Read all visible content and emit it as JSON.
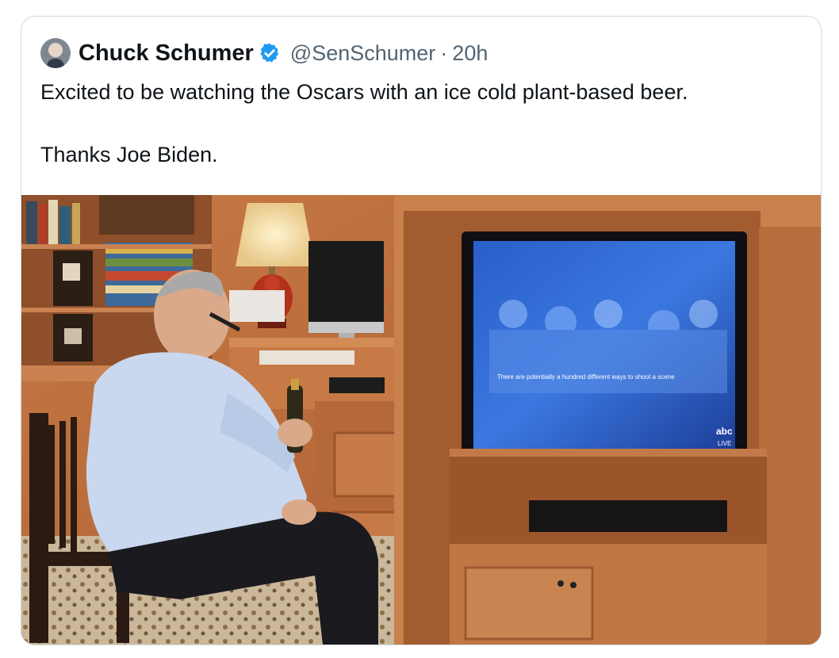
{
  "tweet": {
    "author_name": "Chuck Schumer",
    "author_handle": "@SenSchumer",
    "separator": "·",
    "timestamp": "20h",
    "verified": true,
    "text_lines": [
      "Excited to be watching the Oscars with an ice cold plant-based beer.",
      "Thanks Joe Biden."
    ]
  },
  "colors": {
    "text_primary": "#0f1419",
    "text_secondary": "#536471",
    "verified_blue": "#1d9bf0",
    "card_border": "#cfd9de"
  },
  "media": {
    "tv_screen_caption": "There are potentially a hundred different ways to shoot a scene",
    "tv_logo": "abc",
    "tv_logo_sub": "LIVE"
  }
}
